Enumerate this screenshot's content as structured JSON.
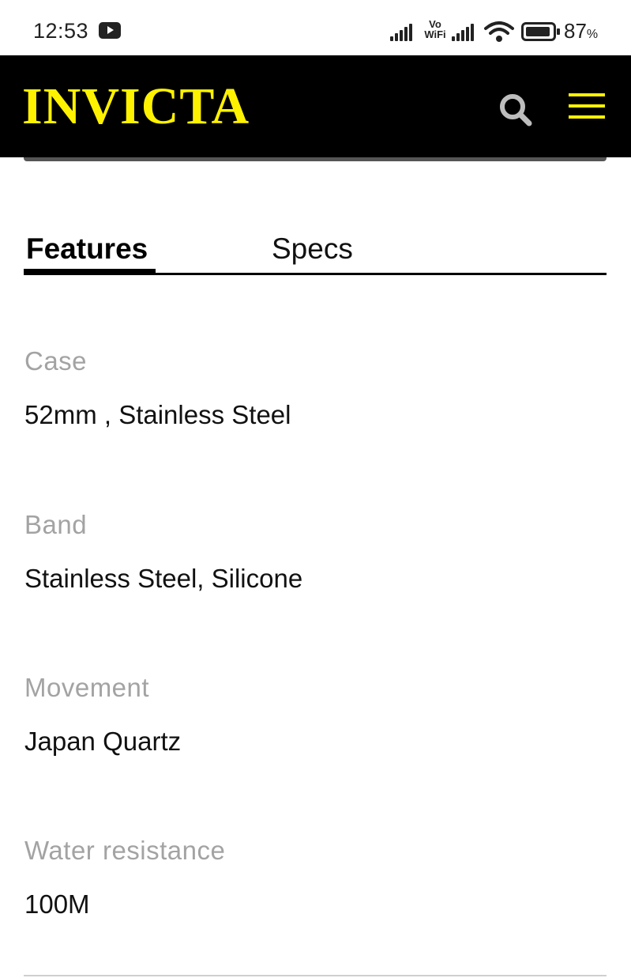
{
  "status_bar": {
    "time": "12:53",
    "network_label_top": "Vo",
    "network_label_bottom": "WiFi",
    "battery_percent": "87",
    "battery_unit": "%"
  },
  "header": {
    "logo": "INVICTA",
    "logo_color": "#fff200",
    "search_icon": "search-icon",
    "menu_icon": "hamburger-menu-icon"
  },
  "tabs": [
    {
      "label": "Features",
      "active": true
    },
    {
      "label": "Specs",
      "active": false
    }
  ],
  "features": [
    {
      "label": "Case",
      "value": "52mm ,  Stainless Steel"
    },
    {
      "label": "Band",
      "value": "Stainless Steel, Silicone"
    },
    {
      "label": "Movement",
      "value": "Japan Quartz"
    },
    {
      "label": "Water resistance",
      "value": "100M"
    }
  ]
}
